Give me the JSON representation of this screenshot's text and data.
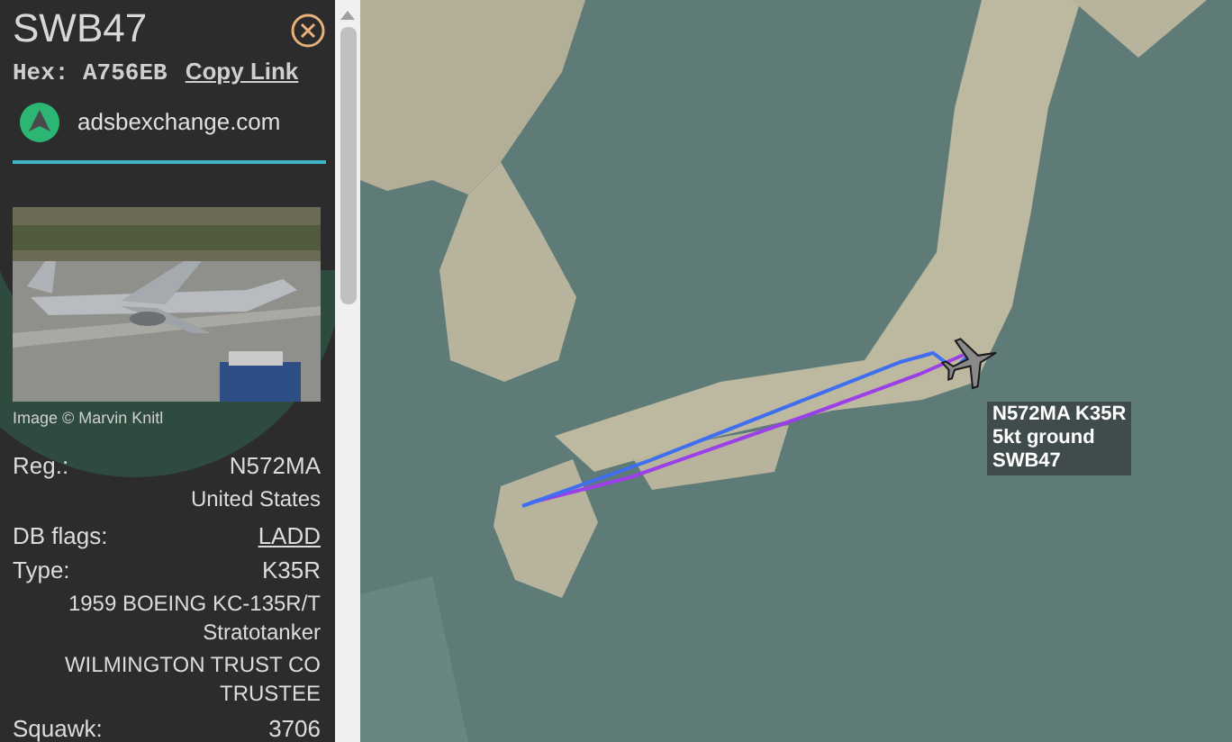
{
  "panel": {
    "callsign": "SWB47",
    "hex_label": "Hex:",
    "hex": "A756EB",
    "copy_link": "Copy Link",
    "source": "adsbexchange.com",
    "photo_credit": "Image © Marvin Knitl",
    "details": [
      {
        "kind": "pair",
        "label": "Reg.:",
        "value": "N572MA"
      },
      {
        "kind": "plain",
        "value": "United States"
      },
      {
        "kind": "link",
        "label": "DB flags:",
        "value": "LADD"
      },
      {
        "kind": "pair",
        "label": "Type:",
        "value": "K35R"
      },
      {
        "kind": "plain",
        "value": "1959 BOEING KC-135R/T Stratotanker"
      },
      {
        "kind": "plain",
        "value": "WILMINGTON TRUST CO TRUSTEE"
      },
      {
        "kind": "pair",
        "label": "Squawk:",
        "value": "3706"
      }
    ]
  },
  "map": {
    "aircraft_label": [
      "N572MA K35R",
      "5kt ground",
      "SWB47"
    ]
  }
}
